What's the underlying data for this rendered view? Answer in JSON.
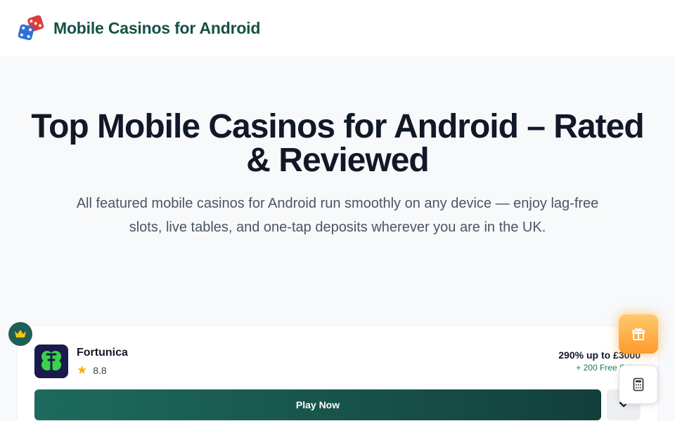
{
  "header": {
    "title": "Mobile Casinos for Android",
    "logo_icon": "dice-icon"
  },
  "hero": {
    "heading": "Top Mobile Casinos for Android – Rated & Reviewed",
    "subtitle": "All featured mobile casinos for Android run smoothly on any device — enjoy lag-free slots, live tables, and one-tap deposits wherever you are in the UK."
  },
  "casino_card": {
    "rank_badge_icon": "crown-icon",
    "name": "Fortunica",
    "rating": "8.8",
    "bonus": "290% up to £3000",
    "bonus_extra": "+ 200 Free Spins",
    "play_label": "Play Now",
    "expand_icon": "chevron-down-icon"
  },
  "floating": {
    "gift_icon": "gift-icon",
    "calculator_icon": "calculator-icon"
  },
  "colors": {
    "brand": "#155146",
    "button_gradient_start": "#1d6b5e",
    "button_gradient_end": "#133f3a",
    "star": "#f5b400",
    "gift": "#ffa53a"
  }
}
